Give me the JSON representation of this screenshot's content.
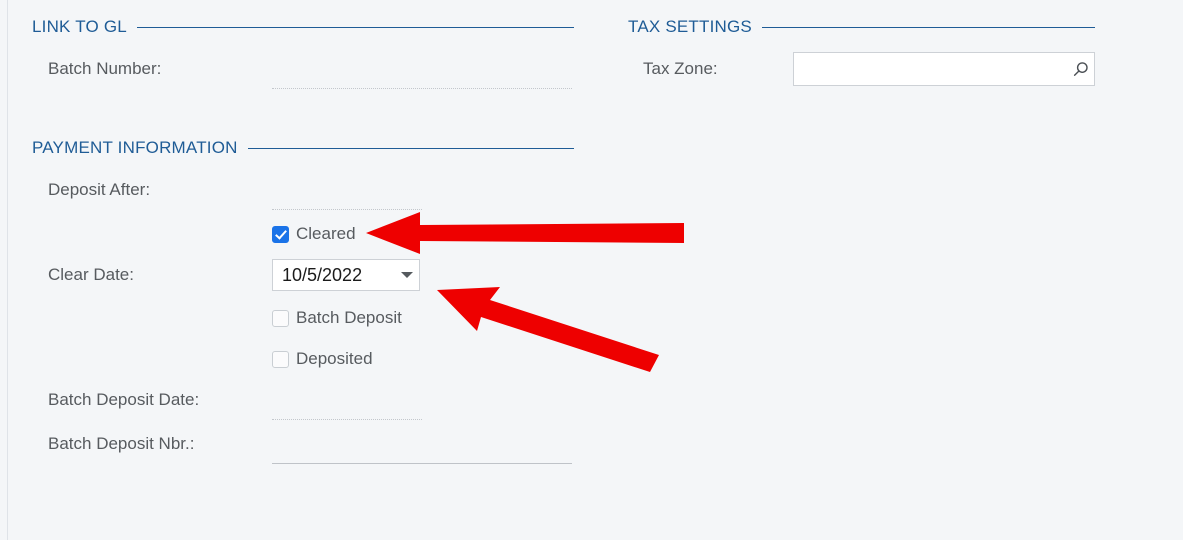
{
  "theme": {
    "background": "#f4f6f8",
    "section_header_color": "#1f5c96",
    "label_color": "#575b5f",
    "checkbox_checked_color": "#1a73e8",
    "annotation_color": "#ee0000",
    "input_border_color": "#cdd1d6"
  },
  "sections": {
    "link_to_gl": {
      "title": "LINK TO GL",
      "batch_number_label": "Batch Number:",
      "batch_number_value": ""
    },
    "tax_settings": {
      "title": "TAX SETTINGS",
      "tax_zone_label": "Tax Zone:",
      "tax_zone_value": "",
      "tax_zone_placeholder": "",
      "search_icon": "search-icon"
    },
    "payment_information": {
      "title": "PAYMENT INFORMATION",
      "deposit_after_label": "Deposit After:",
      "deposit_after_value": "",
      "cleared_label": "Cleared",
      "cleared_checked": true,
      "clear_date_label": "Clear Date:",
      "clear_date_value": "10/5/2022",
      "clear_date_dropdown_icon": "chevron-down-icon",
      "batch_deposit_label": "Batch Deposit",
      "batch_deposit_checked": false,
      "deposited_label": "Deposited",
      "deposited_checked": false,
      "batch_deposit_date_label": "Batch Deposit Date:",
      "batch_deposit_date_value": "",
      "batch_deposit_nbr_label": "Batch Deposit Nbr.:",
      "batch_deposit_nbr_value": ""
    }
  },
  "annotations": {
    "arrow_1": "arrow pointing left at Cleared checkbox",
    "arrow_2": "arrow pointing up-left at Clear Date field"
  }
}
